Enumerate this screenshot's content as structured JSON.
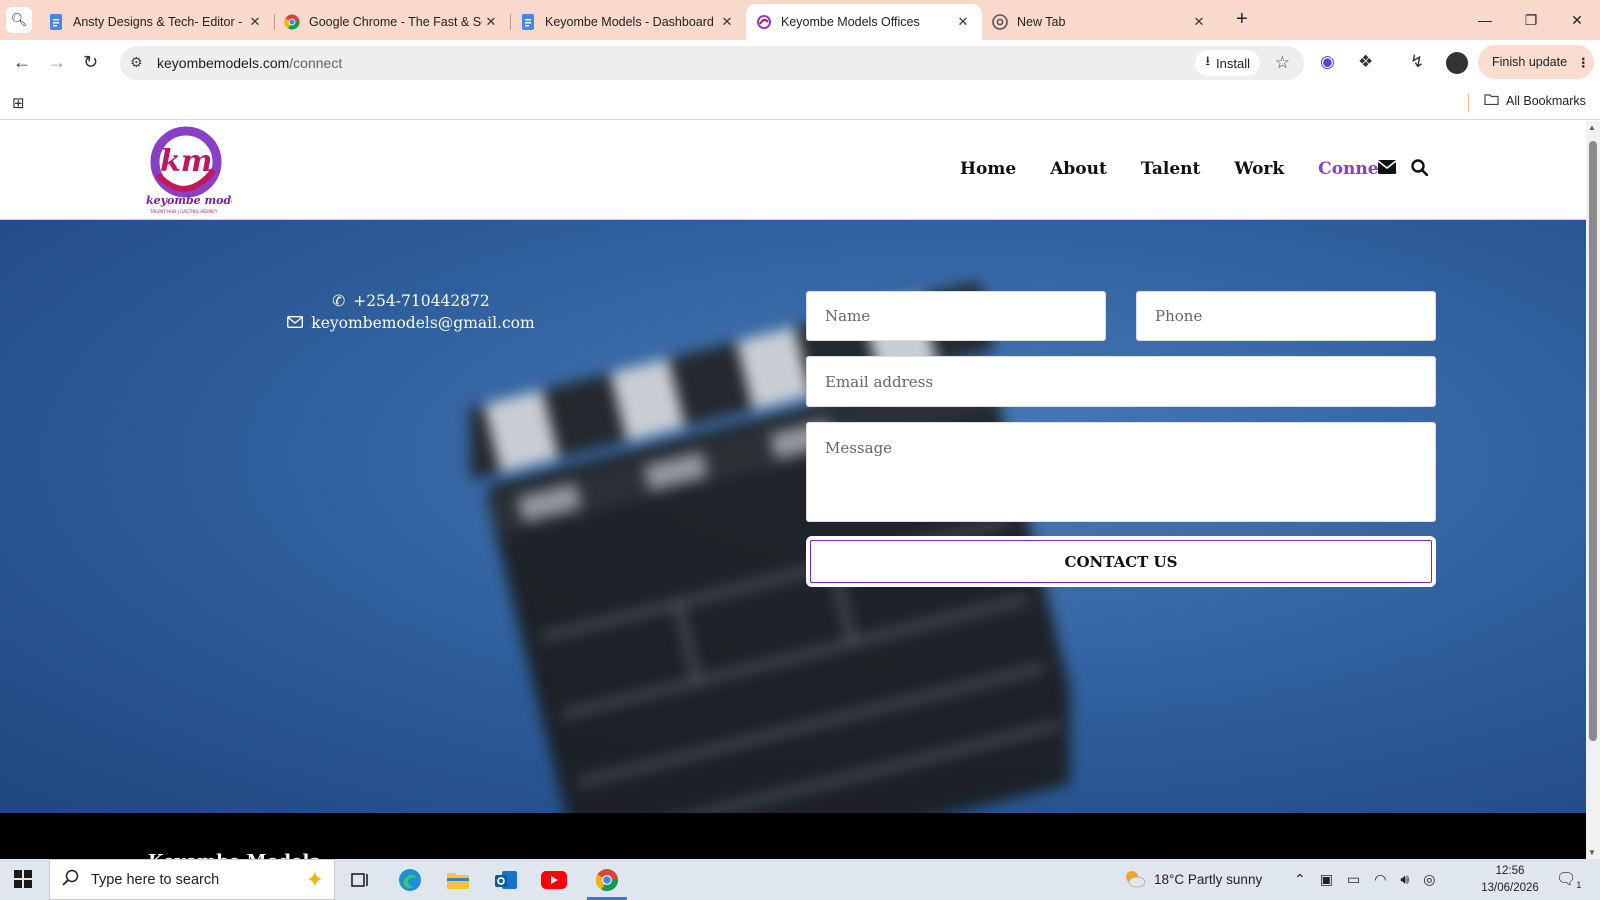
{
  "browser": {
    "tabs": [
      {
        "title": "Ansty Designs & Tech- Editor -",
        "favicon": "docs-icon",
        "active": false
      },
      {
        "title": "Google Chrome - The Fast & Se",
        "favicon": "chrome-icon",
        "active": false
      },
      {
        "title": "Keyombe Models - Dashboard",
        "favicon": "docs-icon",
        "active": false
      },
      {
        "title": "Keyombe Models Offices",
        "favicon": "keyombe-icon",
        "active": true
      },
      {
        "title": "New Tab",
        "favicon": "chrome-icon",
        "active": false
      }
    ],
    "url_host": "keyombemodels.com",
    "url_path": "/connect",
    "install_label": "Install",
    "finish_update_label": "Finish update",
    "all_bookmarks_label": "All Bookmarks",
    "colors": {
      "tabstrip": "#f9d9cb",
      "accent": "#8a3fc7"
    }
  },
  "site": {
    "logo_text": "keyombe models",
    "logo_tagline": "TALENT HUB | CASTING AGENCY",
    "logo_mark": "km",
    "nav": [
      {
        "label": "Home",
        "active": false
      },
      {
        "label": "About",
        "active": false
      },
      {
        "label": "Talent",
        "active": false
      },
      {
        "label": "Work",
        "active": false
      },
      {
        "label": "Connect",
        "active": true
      }
    ],
    "contact": {
      "phone": "+254-710442872",
      "email": "keyombemodels@gmail.com"
    },
    "form": {
      "name_placeholder": "Name",
      "phone_placeholder": "Phone",
      "email_placeholder": "Email address",
      "message_placeholder": "Message",
      "submit_label": "CONTACT US"
    },
    "footer_title": "Keyombe Models"
  },
  "taskbar": {
    "search_placeholder": "Type here to search",
    "weather": "18°C  Partly sunny",
    "time": "12:56",
    "date": "13/06/2026",
    "notification_count": "1"
  }
}
